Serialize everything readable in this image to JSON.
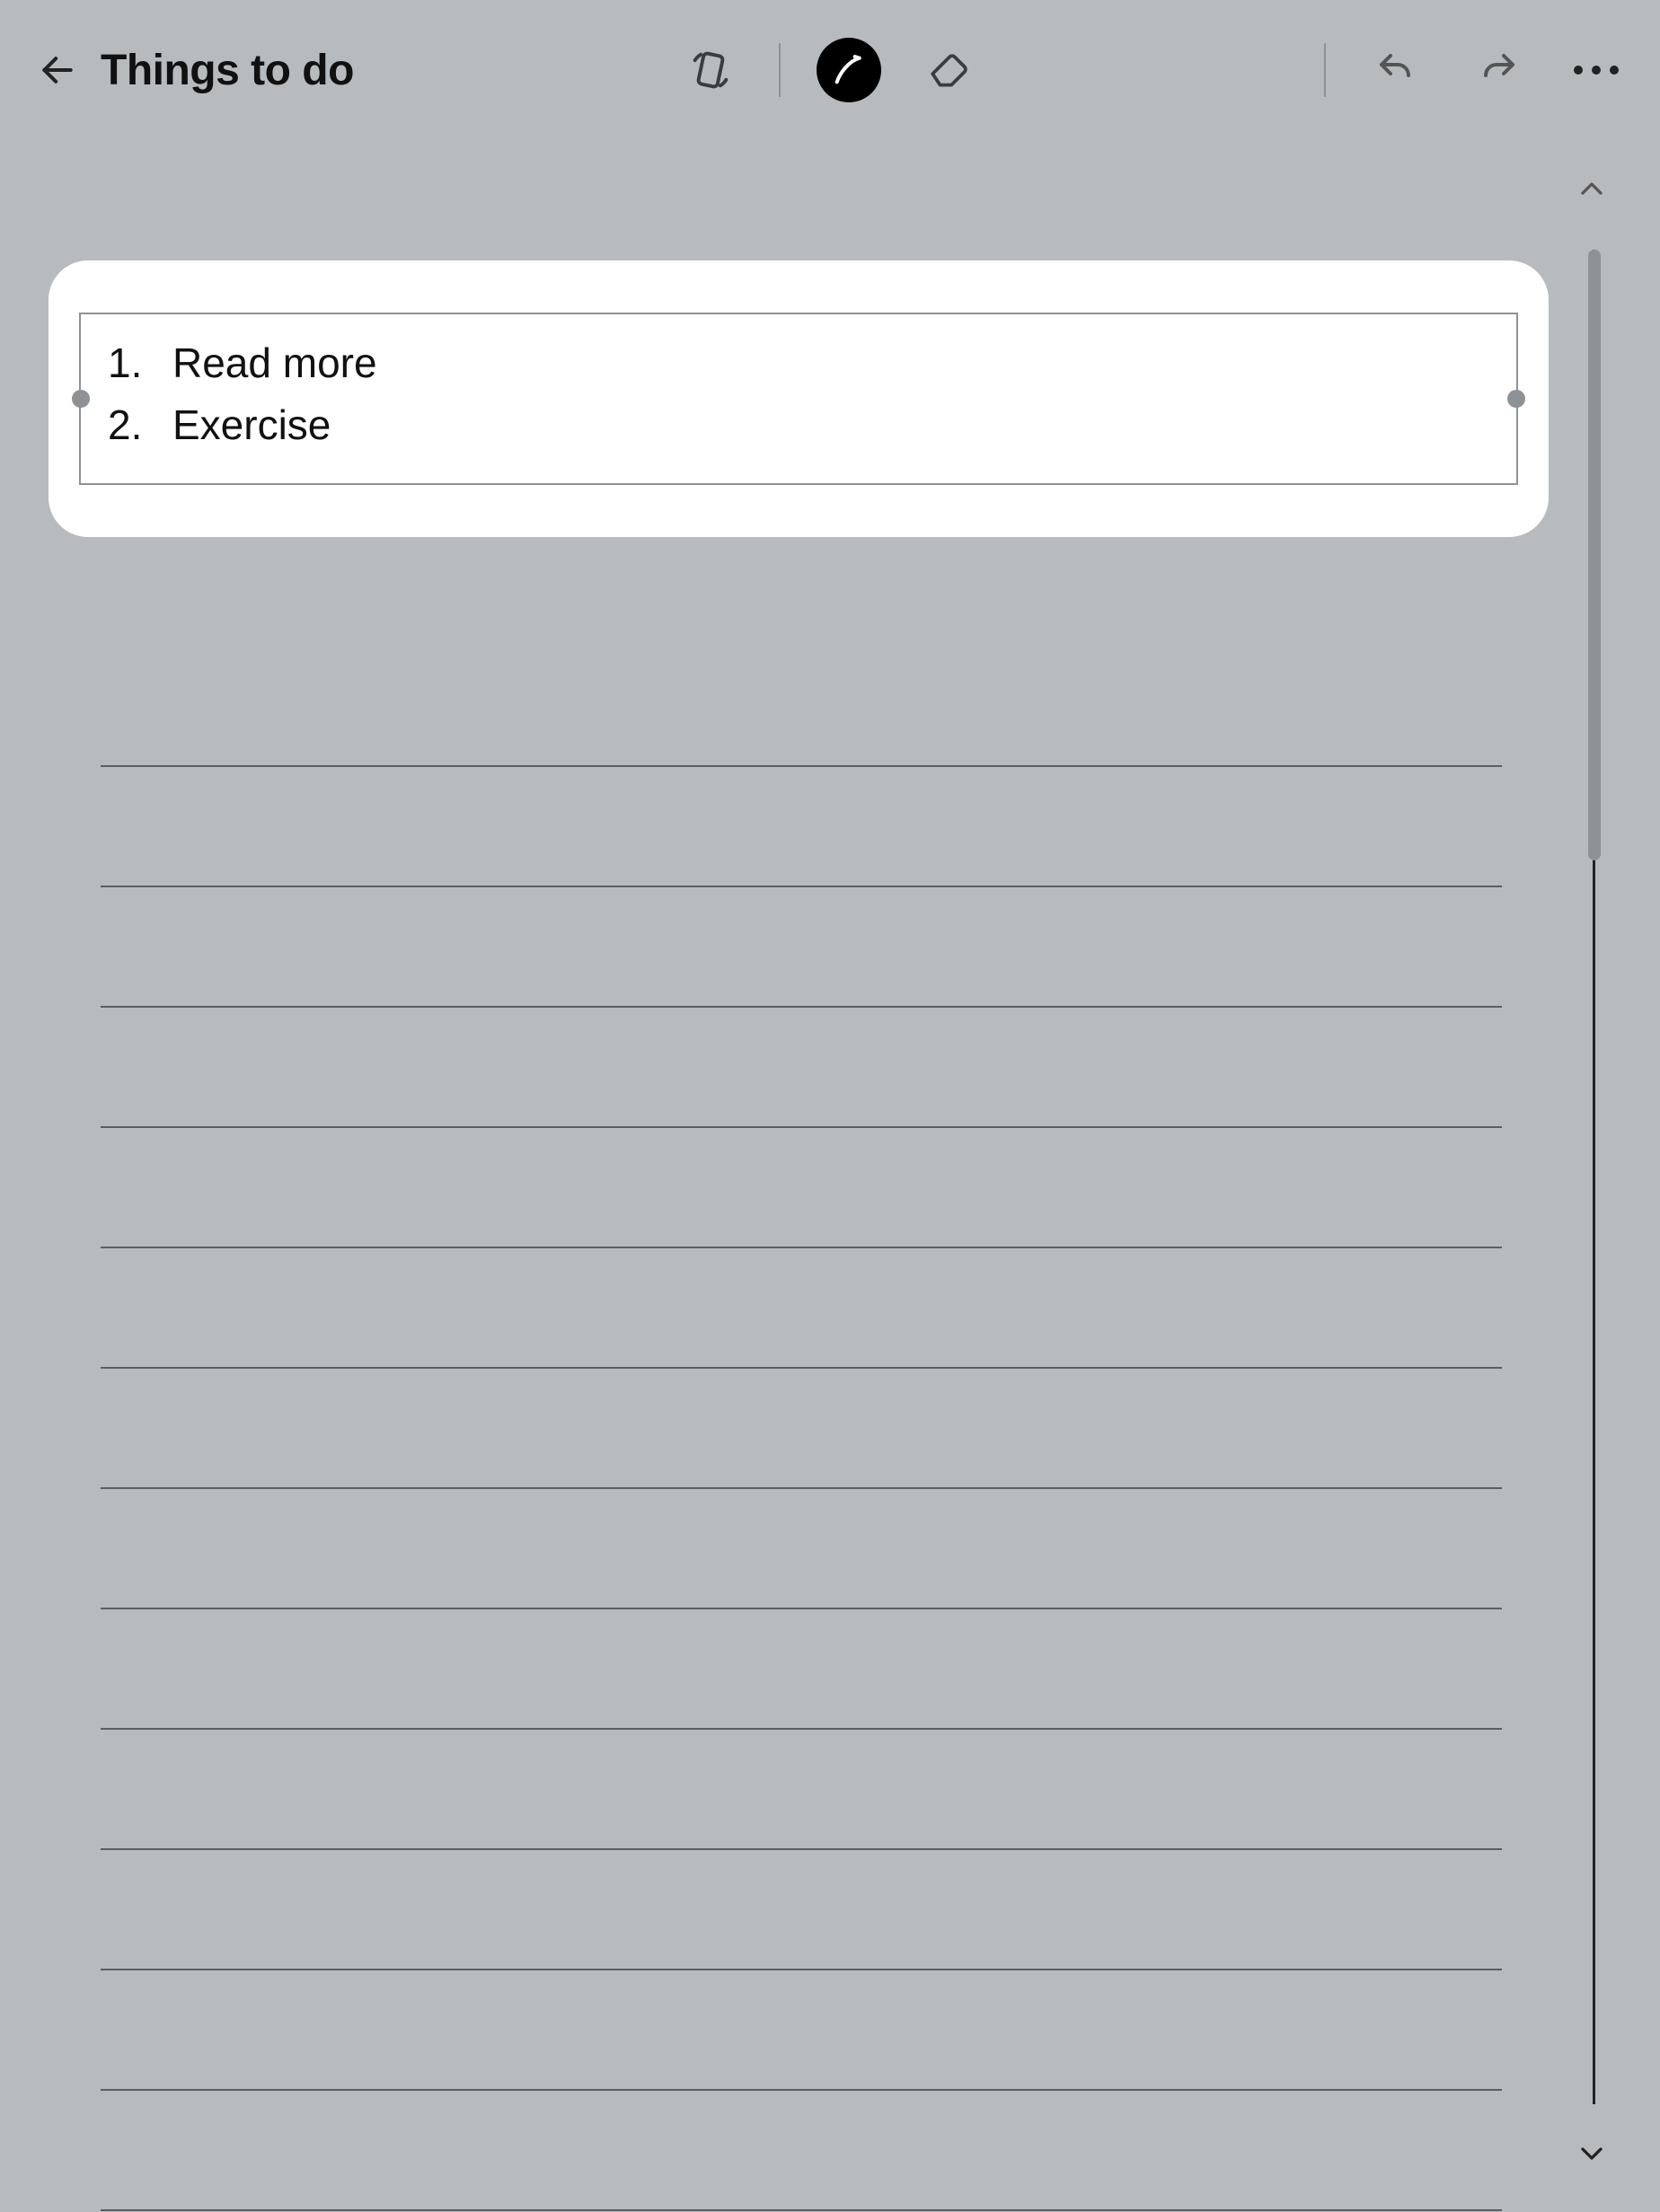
{
  "header": {
    "title": "Things to do"
  },
  "list": {
    "items": [
      {
        "num": "1.",
        "text": "Read more"
      },
      {
        "num": "2.",
        "text": "Exercise"
      }
    ]
  },
  "ruled_line_count": 13
}
